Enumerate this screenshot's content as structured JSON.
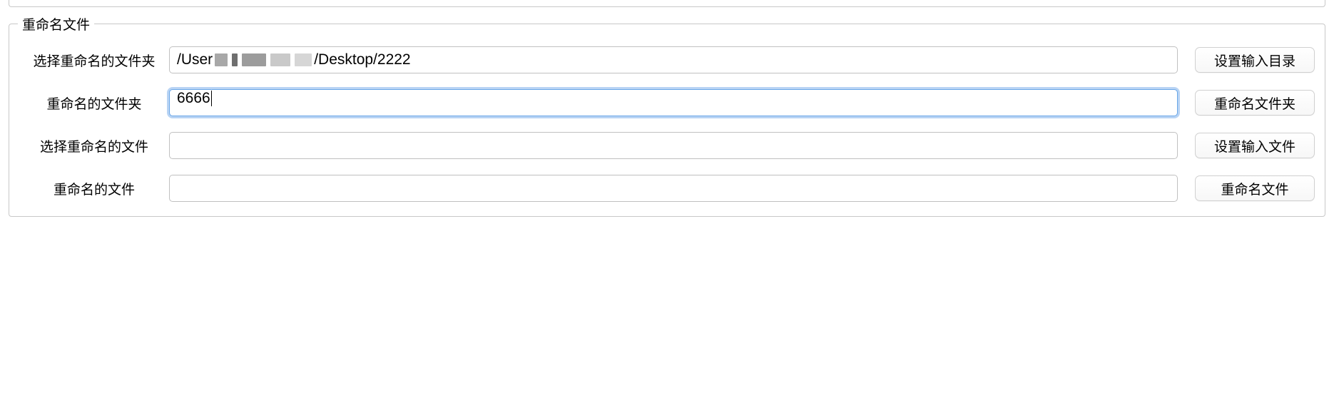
{
  "group": {
    "legend": "重命名文件"
  },
  "rows": {
    "select_folder": {
      "label": "选择重命名的文件夹",
      "path_prefix": "/User",
      "path_suffix": "/Desktop/2222",
      "button": "设置输入目录"
    },
    "rename_folder": {
      "label": "重命名的文件夹",
      "value": "6666",
      "button": "重命名文件夹"
    },
    "select_file": {
      "label": "选择重命名的文件",
      "value": "",
      "button": "设置输入文件"
    },
    "rename_file": {
      "label": "重命名的文件",
      "value": "",
      "button": "重命名文件"
    }
  }
}
